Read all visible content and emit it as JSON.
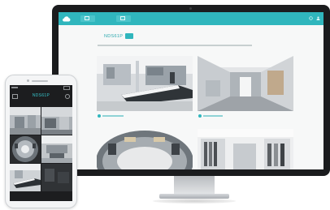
{
  "monitor": {
    "screen": {
      "topbar": {
        "color": "#30b6bd",
        "brand_icon": "cloud-icon",
        "tabs": [
          {
            "label": "",
            "icon": "monitor-icon"
          },
          {
            "label": "",
            "icon": "camera-icon"
          }
        ],
        "right_icons": [
          "settings-icon",
          "user-icon"
        ]
      },
      "device_title": "NDS61P",
      "title_badge": "",
      "subtitle": "",
      "cameras": [
        {
          "caption": ""
        },
        {
          "caption": ""
        },
        {
          "caption": ""
        },
        {
          "caption": ""
        }
      ]
    }
  },
  "phone": {
    "title": "NDS61P",
    "header_icons": [
      "menu-icon",
      "refresh-icon"
    ],
    "cameras": [
      "view-1",
      "view-2",
      "view-3",
      "view-4",
      "view-5",
      "view-6"
    ]
  },
  "colors": {
    "accent": "#30b6bd",
    "bezel": "#1b1c1e"
  }
}
